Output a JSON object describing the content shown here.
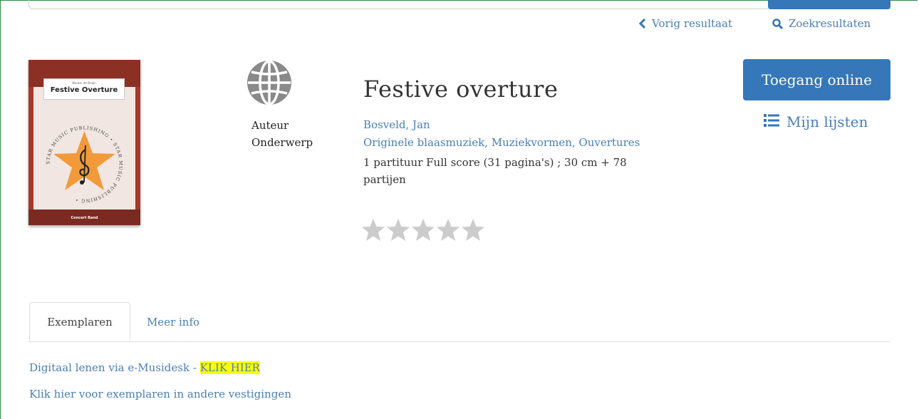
{
  "nav": {
    "prev_label": "Vorig resultaat",
    "search_label": "Zoekresultaten"
  },
  "cover": {
    "small_text": "Wouter de Bruijn",
    "title": "Festive Overture",
    "band_label": "Concert Band",
    "emblem_ring_text": "STAR MUSIC PUBLISHING • STAR MUSIC PUBLISHING •"
  },
  "meta": {
    "author_label": "Auteur",
    "subject_label": "Onderwerp"
  },
  "record": {
    "title": "Festive overture",
    "author": "Bosveld, Jan",
    "subjects": [
      "Originele blaasmuziek",
      "Muziekvormen",
      "Ouvertures"
    ],
    "subject_separator": ", ",
    "description": "1 partituur Full score (31 pagina's) ; 30 cm + 78 partijen",
    "rating": 0,
    "rating_max": 5
  },
  "actions": {
    "online_label": "Toegang online",
    "lists_label": "Mijn lijsten"
  },
  "tabs": [
    {
      "label": "Exemplaren",
      "active": true
    },
    {
      "label": "Meer info",
      "active": false
    }
  ],
  "content": {
    "lend_text": "Digitaal lenen via e-Musidesk - ",
    "lend_link": "KLIK HIER",
    "branches_link": "Klik hier voor exemplaren in andere vestigingen"
  },
  "colors": {
    "accent": "#3577b8",
    "link": "#4a7fb5",
    "highlight": "#ffff00",
    "star_empty": "#cccccc",
    "frame": "#2e8b3e"
  }
}
